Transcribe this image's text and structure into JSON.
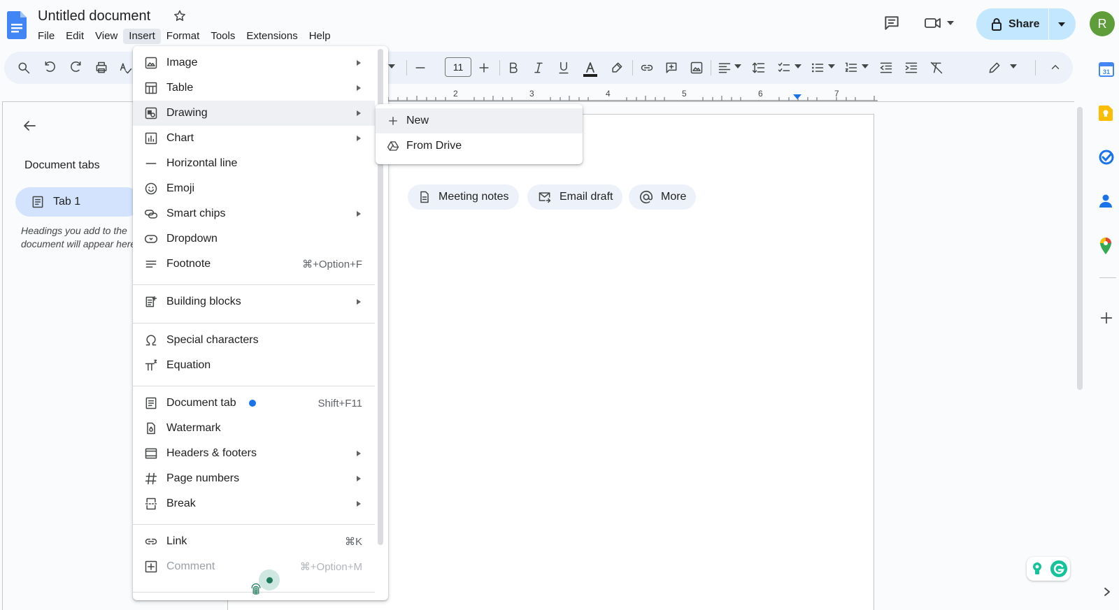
{
  "doc": {
    "title": "Untitled document",
    "menus": [
      "File",
      "Edit",
      "View",
      "Insert",
      "Format",
      "Tools",
      "Extensions",
      "Help"
    ],
    "active_menu": "Insert"
  },
  "header": {
    "share_label": "Share",
    "avatar_initial": "R"
  },
  "toolbar": {
    "font_size": "11"
  },
  "ruler": {
    "numbers": [
      "2",
      "3",
      "4",
      "5",
      "6",
      "7"
    ]
  },
  "left_panel": {
    "heading": "Document tabs",
    "tab_label": "Tab 1",
    "hint": "Headings you add to the document will appear here."
  },
  "chips": [
    {
      "label": "Meeting notes",
      "icon": "document-icon"
    },
    {
      "label": "Email draft",
      "icon": "email-icon"
    },
    {
      "label": "More",
      "icon": "at-sign-icon"
    }
  ],
  "insert_menu": {
    "items": [
      {
        "label": "Image",
        "icon": "image-icon",
        "submenu": true
      },
      {
        "label": "Table",
        "icon": "table-icon",
        "submenu": true
      },
      {
        "label": "Drawing",
        "icon": "drawing-icon",
        "submenu": true,
        "hover": true
      },
      {
        "label": "Chart",
        "icon": "chart-icon",
        "submenu": true
      },
      {
        "label": "Horizontal line",
        "icon": "horizontal-line-icon"
      },
      {
        "label": "Emoji",
        "icon": "emoji-icon"
      },
      {
        "label": "Smart chips",
        "icon": "smart-chips-icon",
        "submenu": true
      },
      {
        "label": "Dropdown",
        "icon": "dropdown-icon"
      },
      {
        "label": "Footnote",
        "icon": "footnote-icon",
        "shortcut": "⌘+Option+F"
      },
      {
        "label": "Building blocks",
        "icon": "building-blocks-icon",
        "submenu": true
      },
      {
        "label": "Special characters",
        "icon": "omega-icon"
      },
      {
        "label": "Equation",
        "icon": "pi-icon"
      },
      {
        "label": "Document tab",
        "icon": "document-tab-icon",
        "shortcut": "Shift+F11",
        "new_badge": true
      },
      {
        "label": "Watermark",
        "icon": "watermark-icon"
      },
      {
        "label": "Headers & footers",
        "icon": "headers-footers-icon",
        "submenu": true
      },
      {
        "label": "Page numbers",
        "icon": "hash-icon",
        "submenu": true
      },
      {
        "label": "Break",
        "icon": "break-icon",
        "submenu": true
      },
      {
        "label": "Link",
        "icon": "link-icon",
        "shortcut": "⌘K"
      },
      {
        "label": "Comment",
        "icon": "comment-add-icon",
        "shortcut": "⌘+Option+M",
        "disabled": true
      }
    ]
  },
  "drawing_submenu": {
    "items": [
      {
        "label": "New",
        "icon": "plus-icon"
      },
      {
        "label": "From Drive",
        "icon": "drive-icon"
      }
    ]
  },
  "colors": {
    "accent": "#1a73e8",
    "share_bg": "#c2e7ff",
    "tab_pill_bg": "#d3e3fd",
    "avatar_bg": "#5f9c3a",
    "toolbar_bg": "#edf2fa"
  }
}
